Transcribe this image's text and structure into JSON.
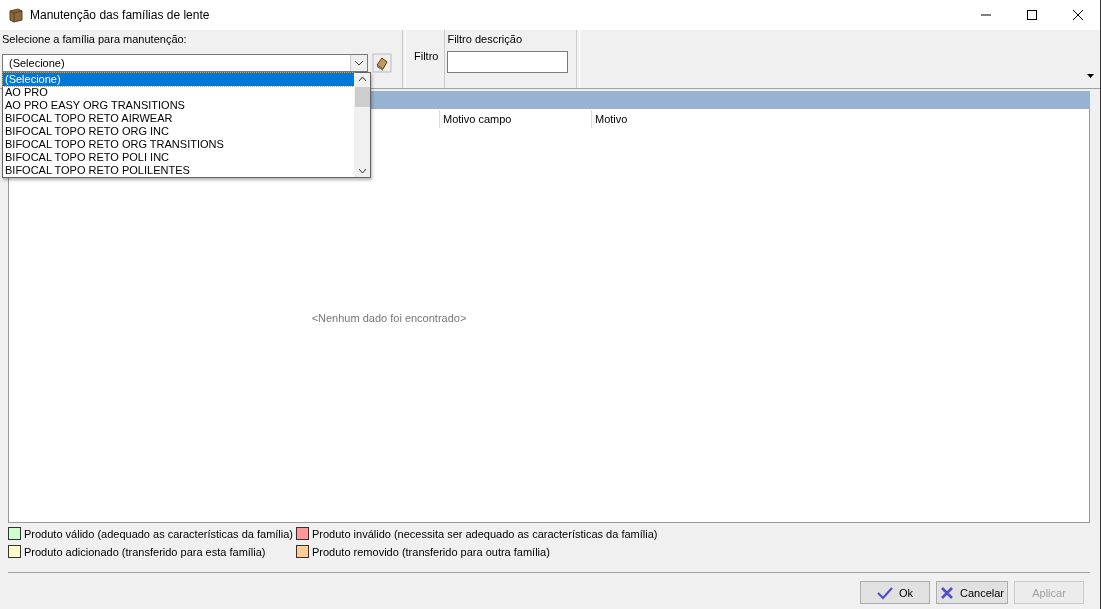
{
  "window": {
    "title": "Manutenção das famílias de lente"
  },
  "family": {
    "label": "Selecione a família para manutenção:",
    "value": "(Selecione)",
    "expanded": true,
    "options": [
      {
        "label": "(Selecione)",
        "selected": true
      },
      {
        "label": "AO PRO",
        "selected": false
      },
      {
        "label": "AO PRO EASY ORG TRANSITIONS",
        "selected": false
      },
      {
        "label": "BIFOCAL TOPO RETO AIRWEAR",
        "selected": false
      },
      {
        "label": "BIFOCAL TOPO RETO ORG INC",
        "selected": false
      },
      {
        "label": "BIFOCAL TOPO RETO ORG TRANSITIONS",
        "selected": false
      },
      {
        "label": "BIFOCAL TOPO RETO POLI INC",
        "selected": false
      },
      {
        "label": "BIFOCAL TOPO RETO POLILENTES",
        "selected": false
      }
    ]
  },
  "filter": {
    "button": "Filtro",
    "label": "Filtro descrição"
  },
  "grid": {
    "columns": [
      "Motivo campo",
      "Motivo"
    ],
    "empty_message": "<Nenhum dado foi encontrado>"
  },
  "legend": [
    {
      "label": "Produto válido (adequado as características da família)",
      "color": "#ccffcc"
    },
    {
      "label": "Produto inválido (necessita ser adequado as características da família)",
      "color": "#ff9999"
    },
    {
      "label": "Produto adicionado (transferido para esta família)",
      "color": "#ffffcc"
    },
    {
      "label": "Produto removido (transferido para outra família)",
      "color": "#ffcc99"
    }
  ],
  "buttons": [
    {
      "label": "Ok",
      "kind": "ok",
      "disabled": false
    },
    {
      "label": "Cancelar",
      "kind": "cancel",
      "disabled": false
    },
    {
      "label": "Aplicar",
      "kind": "apply",
      "disabled": true
    }
  ]
}
